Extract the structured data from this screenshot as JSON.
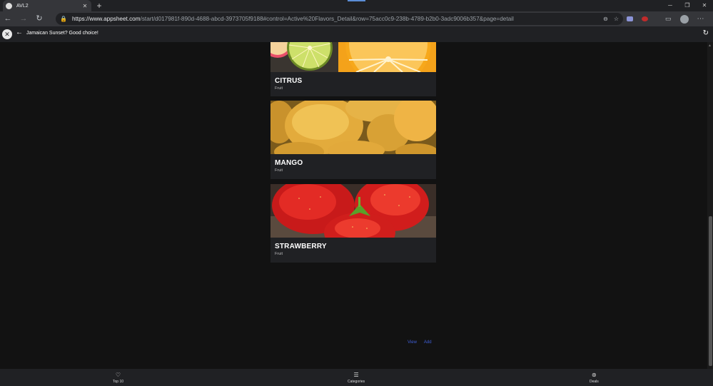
{
  "browser": {
    "tab_title": "AVL2",
    "url_host": "https://www.appsheet.com",
    "url_path": "/start/d017981f-890d-4688-abcd-3973705f9188#control=Active%20Flavors_Detail&row=75acc0c9-238b-4789-b2b0-3adc9006b357&page=detail"
  },
  "app": {
    "title": "Jamaican Sunset? Good choice!"
  },
  "cards": [
    {
      "title": "CITRUS",
      "subtitle": "Fruit"
    },
    {
      "title": "MANGO",
      "subtitle": "Fruit"
    },
    {
      "title": "STRAWBERRY",
      "subtitle": "Fruit"
    }
  ],
  "actions": {
    "view_label": "View",
    "add_label": "Add"
  },
  "bottom_nav": [
    {
      "label": "Top 10",
      "icon": "heart-icon"
    },
    {
      "label": "Categories",
      "icon": "list-icon"
    },
    {
      "label": "Deals",
      "icon": "deals-icon"
    }
  ],
  "colors": {
    "background": "#121212",
    "card": "#202124",
    "link": "#3f5fd8"
  }
}
